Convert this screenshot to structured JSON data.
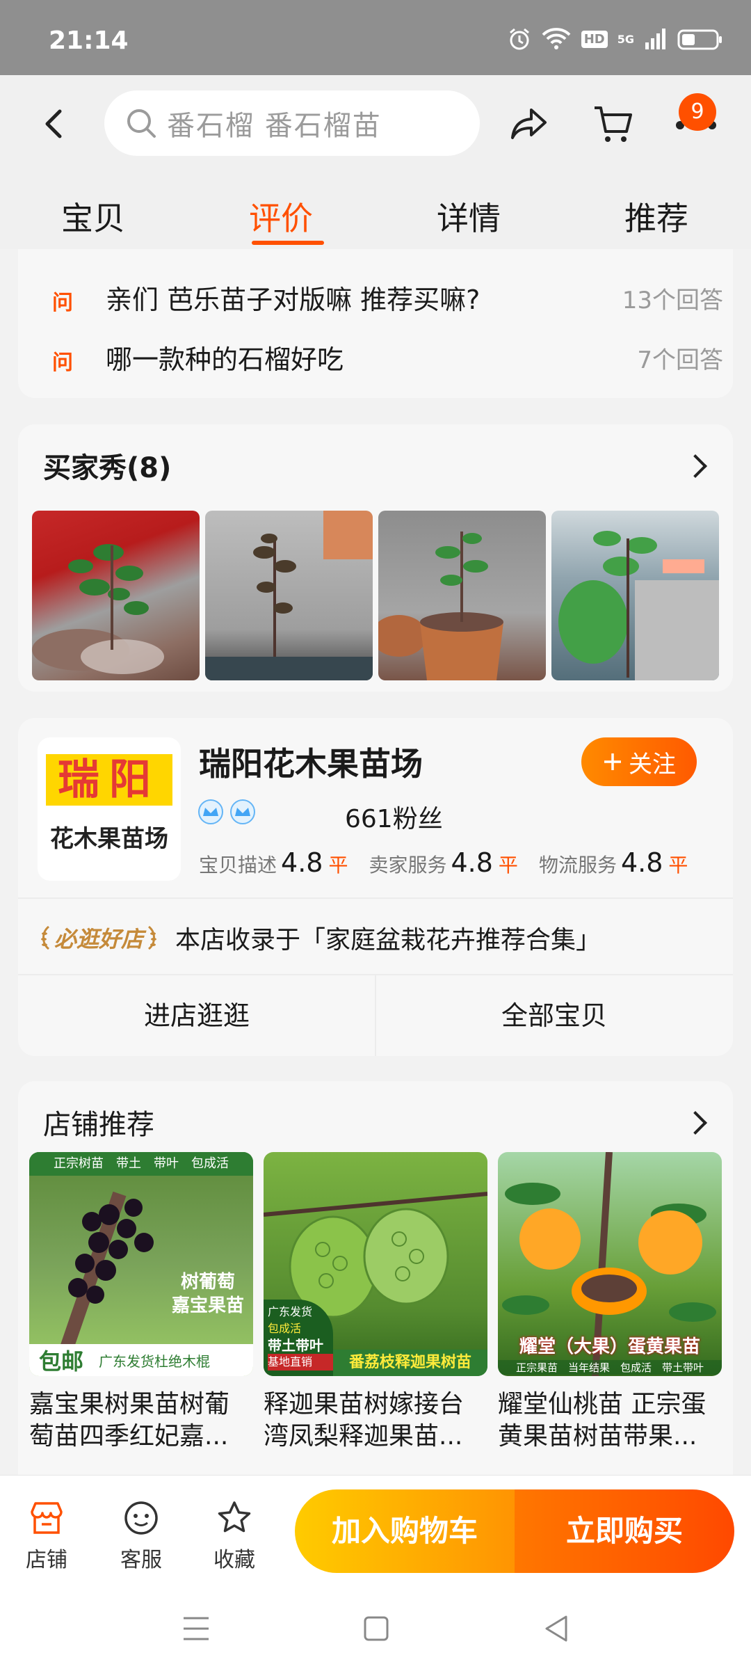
{
  "status_bar": {
    "time": "21:14",
    "network": "5G",
    "hd": "HD"
  },
  "header": {
    "search_placeholder": "番石榴 番石榴苗",
    "message_badge": "9",
    "tabs": [
      {
        "label": "宝贝",
        "active": false
      },
      {
        "label": "评价",
        "active": true
      },
      {
        "label": "详情",
        "active": false
      },
      {
        "label": "推荐",
        "active": false
      }
    ]
  },
  "qa": {
    "icon_char": "问",
    "items": [
      {
        "question": "亲们 芭乐苗子对版嘛 推荐买嘛?",
        "answers": "13个回答"
      },
      {
        "question": "哪一款种的石榴好吃",
        "answers": "7个回答"
      }
    ]
  },
  "buyer_show": {
    "title": "买家秀(8)"
  },
  "shop": {
    "logo_line1": "瑞阳",
    "logo_line2": "花木果苗场",
    "name": "瑞阳花木果苗场",
    "follow_label": "关注",
    "fans": "661粉丝",
    "ratings": [
      {
        "label": "宝贝描述",
        "score": "4.8",
        "level": "平"
      },
      {
        "label": "卖家服务",
        "score": "4.8",
        "level": "平"
      },
      {
        "label": "物流服务",
        "score": "4.8",
        "level": "平"
      }
    ],
    "badge": "必逛好店",
    "collection_text": "本店收录于「家庭盆栽花卉推荐合集」",
    "enter_shop": "进店逛逛",
    "all_items": "全部宝贝"
  },
  "shop_recommend": {
    "title": "店铺推荐",
    "items": [
      {
        "name": "嘉宝果树果苗树葡萄苗四季红妃嘉...",
        "tags": "正宗树苗　带土　带叶　包成活",
        "side_text": "树葡萄 嘉宝果苗",
        "ribbon_left": "包邮",
        "ribbon_right": "广东发货杜绝木棍"
      },
      {
        "name": "释迦果苗树嫁接台湾凤梨释迦果苗...",
        "corner_line1": "广东发货",
        "corner_line2": "包成活",
        "corner_line3": "带土带叶",
        "corner_line4": "基地直销",
        "ribbon": "番荔枝释迦果树苗"
      },
      {
        "name": "耀堂仙桃苗 正宗蛋黄果苗树苗带果...",
        "title_text": "耀堂（大果）蛋黄果苗",
        "sub_text": "正宗果苗　当年结果　包成活　带土带叶"
      }
    ]
  },
  "bottom_bar": {
    "shop_label": "店铺",
    "service_label": "客服",
    "favorite_label": "收藏",
    "add_to_cart": "加入购物车",
    "buy_now": "立即购买"
  },
  "colors": {
    "accent": "#ff5000",
    "cart_btn": "#ffa800",
    "buy_btn": "#ff5a00"
  }
}
